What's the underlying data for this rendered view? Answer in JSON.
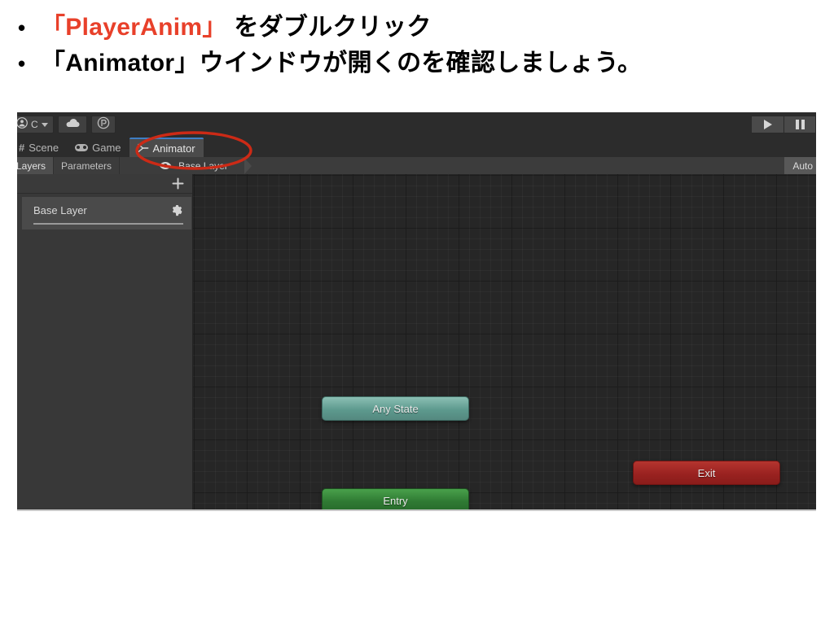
{
  "slide": {
    "bullets": [
      {
        "marker": "•",
        "highlight": "「PlayerAnim」",
        "rest": " をダブルクリック"
      },
      {
        "marker": "•",
        "text": "「Animator」ウインドウが開くのを確認しましょう。"
      }
    ],
    "highlight_color": "#e8402a"
  },
  "unity": {
    "toolbar": {
      "account_label": "C",
      "account_icon": "person-icon",
      "dropdown_icon": "chevron-down-icon",
      "cloud_icon": "cloud-icon",
      "collab_icon": "plastic-scm-icon",
      "play_icon": "play-icon",
      "pause_icon": "pause-icon"
    },
    "dock_tabs": [
      {
        "label": "Scene",
        "icon": "grid-hash-icon",
        "active": false
      },
      {
        "label": "Game",
        "icon": "gamepad-icon",
        "active": false
      },
      {
        "label": "Animator",
        "icon": "animator-icon",
        "active": true
      }
    ],
    "breadcrumb_bar": {
      "tabs": [
        {
          "label": "Layers",
          "selected": true
        },
        {
          "label": "Parameters",
          "selected": false
        }
      ],
      "eye_icon": "eye-icon",
      "crumb": "Base Layer",
      "auto_label": "Auto"
    },
    "layers_panel": {
      "add_icon": "plus-icon",
      "layers": [
        {
          "name": "Base Layer",
          "settings_icon": "gear-icon",
          "weight": 100
        }
      ]
    },
    "graph": {
      "nodes": [
        {
          "id": "any-state",
          "label": "Any State",
          "color": "#5d9a8e"
        },
        {
          "id": "entry",
          "label": "Entry",
          "color": "#2f7a33"
        },
        {
          "id": "exit",
          "label": "Exit",
          "color": "#9a2220"
        }
      ]
    },
    "annotation": {
      "shape": "ellipse",
      "color": "#cc2a16",
      "targets": "Animator tab"
    }
  }
}
